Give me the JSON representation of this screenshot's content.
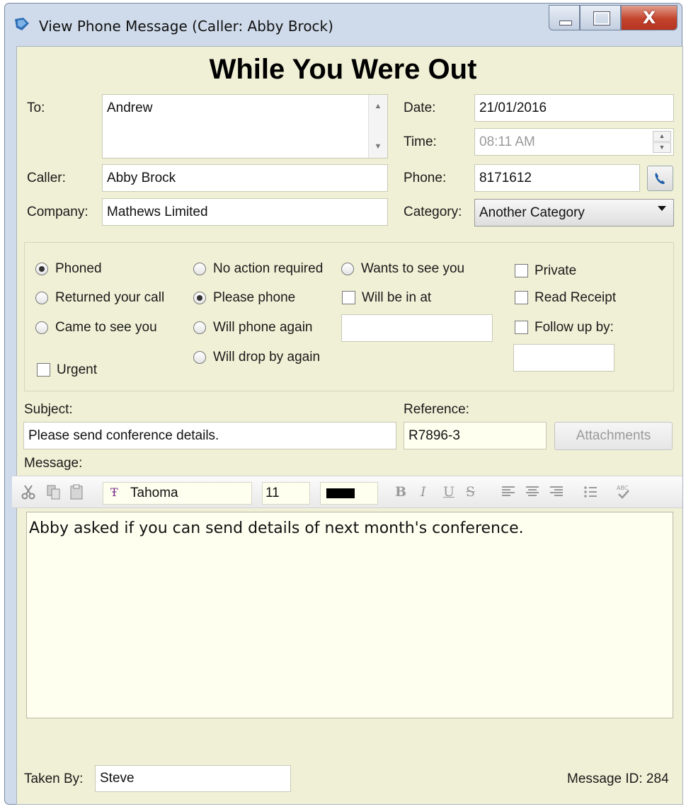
{
  "window": {
    "title": "View Phone Message (Caller: Abby Brock)",
    "close_glyph": "X"
  },
  "heading": "While You Were Out",
  "to": {
    "label": "To:",
    "value": "Andrew"
  },
  "date": {
    "label": "Date:",
    "value": "21/01/2016"
  },
  "time": {
    "label": "Time:",
    "value": "08:11 AM"
  },
  "caller": {
    "label": "Caller:",
    "value": "Abby Brock"
  },
  "phone": {
    "label": "Phone:",
    "value": "8171612"
  },
  "company": {
    "label": "Company:",
    "value": "Mathews Limited"
  },
  "category": {
    "label": "Category:",
    "value": "Another Category"
  },
  "options": {
    "phoned": "Phoned",
    "returned_call": "Returned your call",
    "came_to_see": "Came to see you",
    "urgent": "Urgent",
    "no_action": "No action required",
    "please_phone": "Please phone",
    "will_phone_again": "Will phone again",
    "will_drop_by": "Will drop by again",
    "wants_to_see": "Wants to see you",
    "will_be_in_at": "Will be in at",
    "private": "Private",
    "read_receipt": "Read Receipt",
    "follow_up": "Follow up by:"
  },
  "subject": {
    "label": "Subject:",
    "value": "Please send conference details."
  },
  "reference": {
    "label": "Reference:",
    "value": "R7896-3"
  },
  "attachments_label": "Attachments",
  "message": {
    "label": "Message:",
    "font": "Tahoma",
    "size": "11",
    "text": "Abby asked if you can send details of next month's conference.",
    "formats": [
      "B",
      "I",
      "U",
      "S"
    ]
  },
  "taken_by": {
    "label": "Taken By:",
    "value": "Steve"
  },
  "message_id": "Message ID: 284",
  "colors": {
    "window_bg": "#f0f0d6",
    "title_bar": "#cfdbeb",
    "close": "#c4432c",
    "font_color": "#000000"
  }
}
